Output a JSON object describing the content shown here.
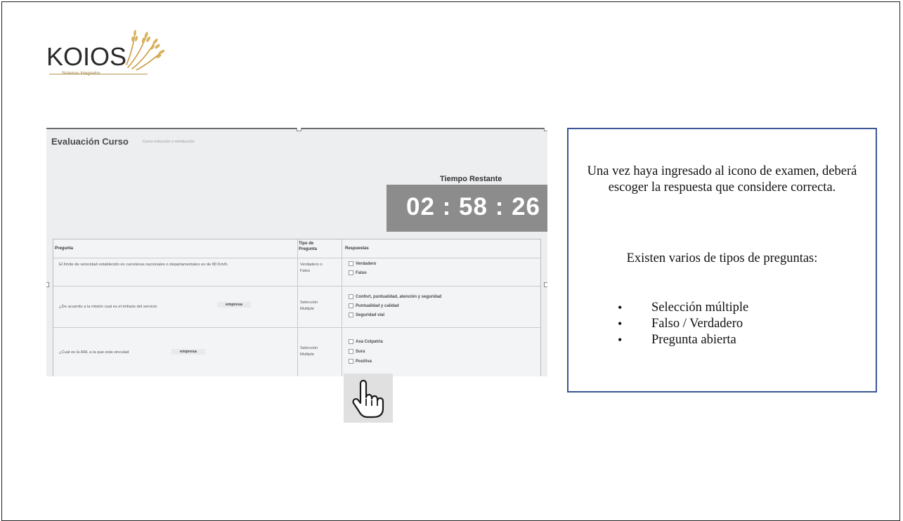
{
  "logo": {
    "brand": "KOIOS",
    "tagline": "Sistemas Integrados"
  },
  "screenshot": {
    "title": "Evaluación Curso",
    "subtitle": "Curso inducción o reinducción",
    "timer": {
      "label": "Tiempo Restante",
      "value": "02 : 58 : 26"
    },
    "table": {
      "headers": [
        "Pregunta",
        "Tipo de Pregunta",
        "Respuestas"
      ],
      "rows": [
        {
          "question": "El límite de velocidad establecido en carreteras nacionales o departamentales es de 80 Km/h.",
          "type": "Verdadero o Falso",
          "answers": [
            "Verdadero",
            "Falso"
          ]
        },
        {
          "question": "¿De acuerdo a la misión cual es el énfasis del servicio",
          "field": "empresa",
          "type": "Selección Multiple",
          "answers": [
            "Confort, puntualidad, atención y seguridad",
            "Puntualidad y calidad",
            "Seguridad vial"
          ]
        },
        {
          "question": "¿Cual es la ARL a la que esta vinculad",
          "field": "empresa",
          "type": "Selección Multiple",
          "answers": [
            "Axa Colpatria",
            "Sura",
            "Positiva"
          ]
        }
      ]
    }
  },
  "info": {
    "paragraph1": "Una vez haya ingresado al icono de examen, deberá escoger la respuesta que considere correcta.",
    "paragraph2": "Existen varios de tipos de preguntas:",
    "bullets": [
      "Selección múltiple",
      "Falso / Verdadero",
      "Pregunta abierta"
    ]
  },
  "colors": {
    "box_border": "#3b5796",
    "timer_bg": "#8c8c8c",
    "logo_gold": "#c99a3c"
  },
  "icons": [
    "hand-pointer-icon",
    "wheat-logo-icon"
  ]
}
